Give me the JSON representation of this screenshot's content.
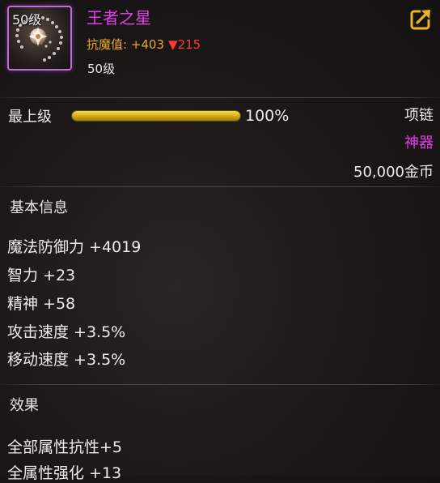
{
  "item": {
    "icon_level": "50级",
    "icon_name": "necklace-icon",
    "name": "王者之星",
    "resist_text": "抗魔值: +403",
    "resist_down": "▼215",
    "req_level": "50级"
  },
  "level_row": {
    "label": "最上级",
    "progress_value": 1.0,
    "progress_text": "100%"
  },
  "meta": {
    "type": "项链",
    "rarity": "神器",
    "price": "50,000金币"
  },
  "basic_info": {
    "title": "基本信息",
    "stats": [
      "魔法防御力 +4019",
      "智力 +23",
      "精神 +58",
      "攻击速度 +3.5%",
      "移动速度 +3.5%"
    ]
  },
  "effects": {
    "title": "效果",
    "lines": [
      "全部属性抗性+5",
      "全属性强化 +13"
    ]
  },
  "colors": {
    "epic_purple": "#e13ee6",
    "resist_gold": "#e8a92c",
    "resist_down_red": "#ff3b35",
    "progress_gold": "#d4a916",
    "share_icon": "#e8b52a"
  },
  "icons": {
    "share": "share-icon"
  }
}
